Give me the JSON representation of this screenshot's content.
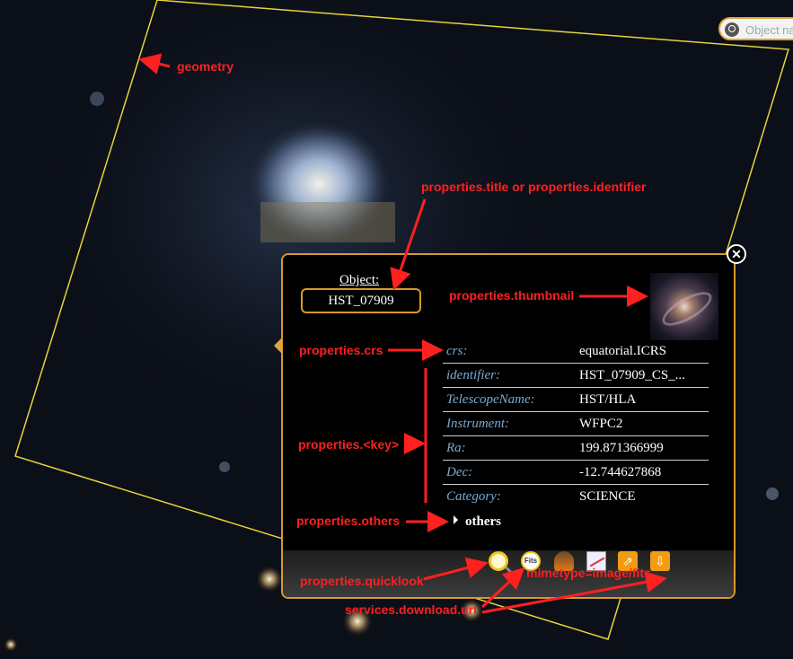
{
  "search": {
    "placeholder": "Object na"
  },
  "popup": {
    "object_label": "Object:",
    "object_name": "HST_07909",
    "close_symbol": "✕",
    "properties": [
      {
        "key": "crs:",
        "value": "equatorial.ICRS"
      },
      {
        "key": "identifier:",
        "value": "HST_07909_CS_..."
      },
      {
        "key": "TelescopeName:",
        "value": "HST/HLA"
      },
      {
        "key": "Instrument:",
        "value": "WFPC2"
      },
      {
        "key": "Ra:",
        "value": "199.871366999"
      },
      {
        "key": "Dec:",
        "value": "-12.744627868"
      },
      {
        "key": "Category:",
        "value": "SCIENCE"
      }
    ],
    "others_label": "others",
    "footer_icons": [
      "quicklook-icon",
      "fits-icon",
      "samp-icon",
      "plot-icon",
      "external-link-icon",
      "download-icon"
    ],
    "fits_icon_text": "Fits",
    "ext_icon_symbol": "⇗",
    "dl_icon_symbol": "⇩"
  },
  "annotations": {
    "geometry": "geometry",
    "title": "properties.title or properties.identifier",
    "thumbnail": "properties.thumbnail",
    "crs": "properties.crs",
    "key": "properties.<key>",
    "others": "properties.others",
    "quicklook": "properties.quicklook",
    "mimetype": "mimetype=image/fits",
    "download": "services.download.url"
  },
  "colors": {
    "annotation": "#ff2020",
    "accent": "#d79a2a",
    "key_text": "#79a9d0",
    "footprint": "#e8d23a"
  }
}
